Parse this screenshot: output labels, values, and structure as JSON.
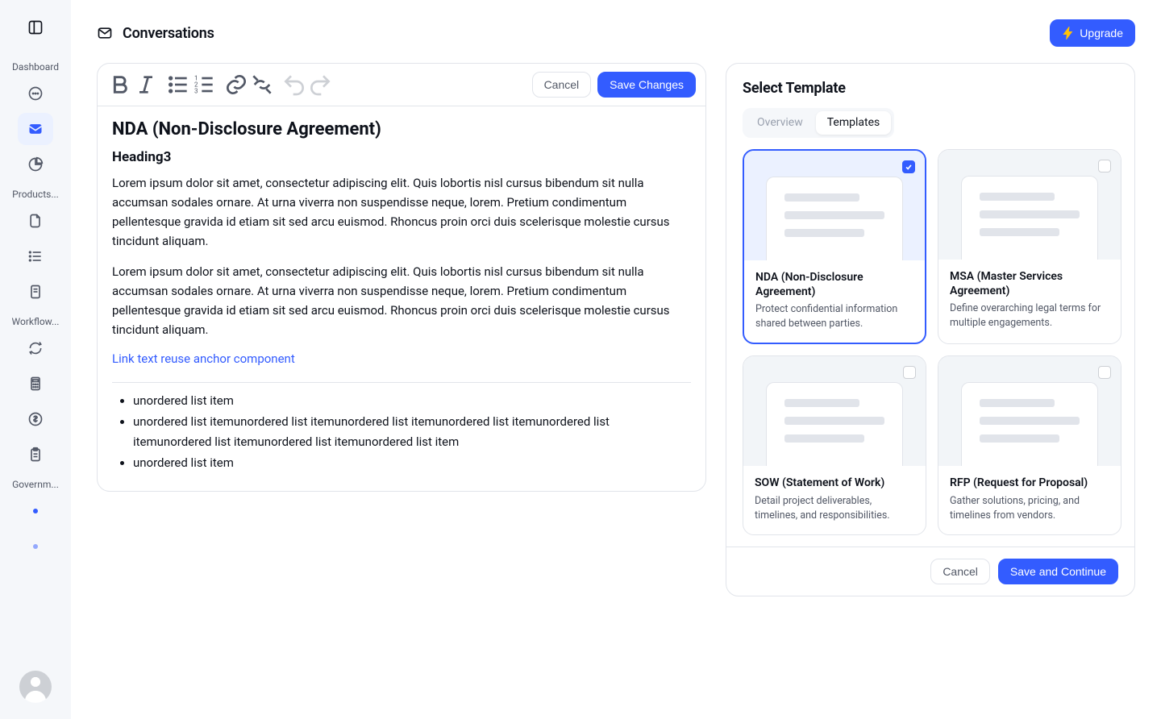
{
  "sidebar": {
    "sections": [
      {
        "label": "Dashboard",
        "items": [
          "chat",
          "mail",
          "chart"
        ],
        "active": "mail"
      },
      {
        "label": "Products...",
        "items": [
          "doc",
          "list",
          "file"
        ]
      },
      {
        "label": "Workflow...",
        "items": [
          "refresh",
          "calc",
          "dollar",
          "clipboard"
        ]
      },
      {
        "label": "Governm...",
        "items": [
          "dot",
          "dot-soft"
        ]
      }
    ]
  },
  "header": {
    "title": "Conversations",
    "upgrade_label": "Upgrade"
  },
  "toolbar": {
    "cancel": "Cancel",
    "save": "Save Changes"
  },
  "document": {
    "h2": "NDA (Non-Disclosure Agreement)",
    "h3": "Heading3",
    "p1": "Lorem ipsum dolor sit amet, consectetur adipiscing elit. Quis lobortis nisl cursus bibendum sit nulla accumsan sodales ornare. At urna viverra non suspendisse neque, lorem. Pretium condimentum pellentesque gravida id etiam sit sed arcu euismod. Rhoncus proin orci duis scelerisque molestie cursus tincidunt aliquam.",
    "p2": "Lorem ipsum dolor sit amet, consectetur adipiscing elit. Quis lobortis nisl cursus bibendum sit nulla accumsan sodales ornare. At urna viverra non suspendisse neque, lorem. Pretium condimentum pellentesque gravida id etiam sit sed arcu euismod. Rhoncus proin orci duis scelerisque molestie cursus tincidunt aliquam.",
    "link": "Link text reuse anchor component",
    "ul": [
      "unordered list item",
      "unordered list itemunordered list itemunordered list itemunordered list itemunordered list itemunordered list itemunordered list itemunordered list item",
      "unordered list item"
    ]
  },
  "panel": {
    "title": "Select Template",
    "tabs": {
      "overview": "Overview",
      "templates": "Templates"
    },
    "footer": {
      "cancel": "Cancel",
      "continue": "Save and Continue"
    },
    "templates": [
      {
        "title": "NDA (Non-Disclosure Agreement)",
        "desc": "Protect confidential information shared between parties.",
        "selected": true
      },
      {
        "title": "MSA (Master Services Agreement)",
        "desc": "Define overarching legal terms for multiple engagements.",
        "selected": false
      },
      {
        "title": "SOW (Statement of Work)",
        "desc": "Detail project deliverables, timelines, and responsibilities.",
        "selected": false
      },
      {
        "title": "RFP (Request for Proposal)",
        "desc": "Gather solutions, pricing, and timelines from vendors.",
        "selected": false
      },
      {
        "title": "",
        "desc": "",
        "selected": false
      },
      {
        "title": "",
        "desc": "",
        "selected": false
      }
    ]
  }
}
